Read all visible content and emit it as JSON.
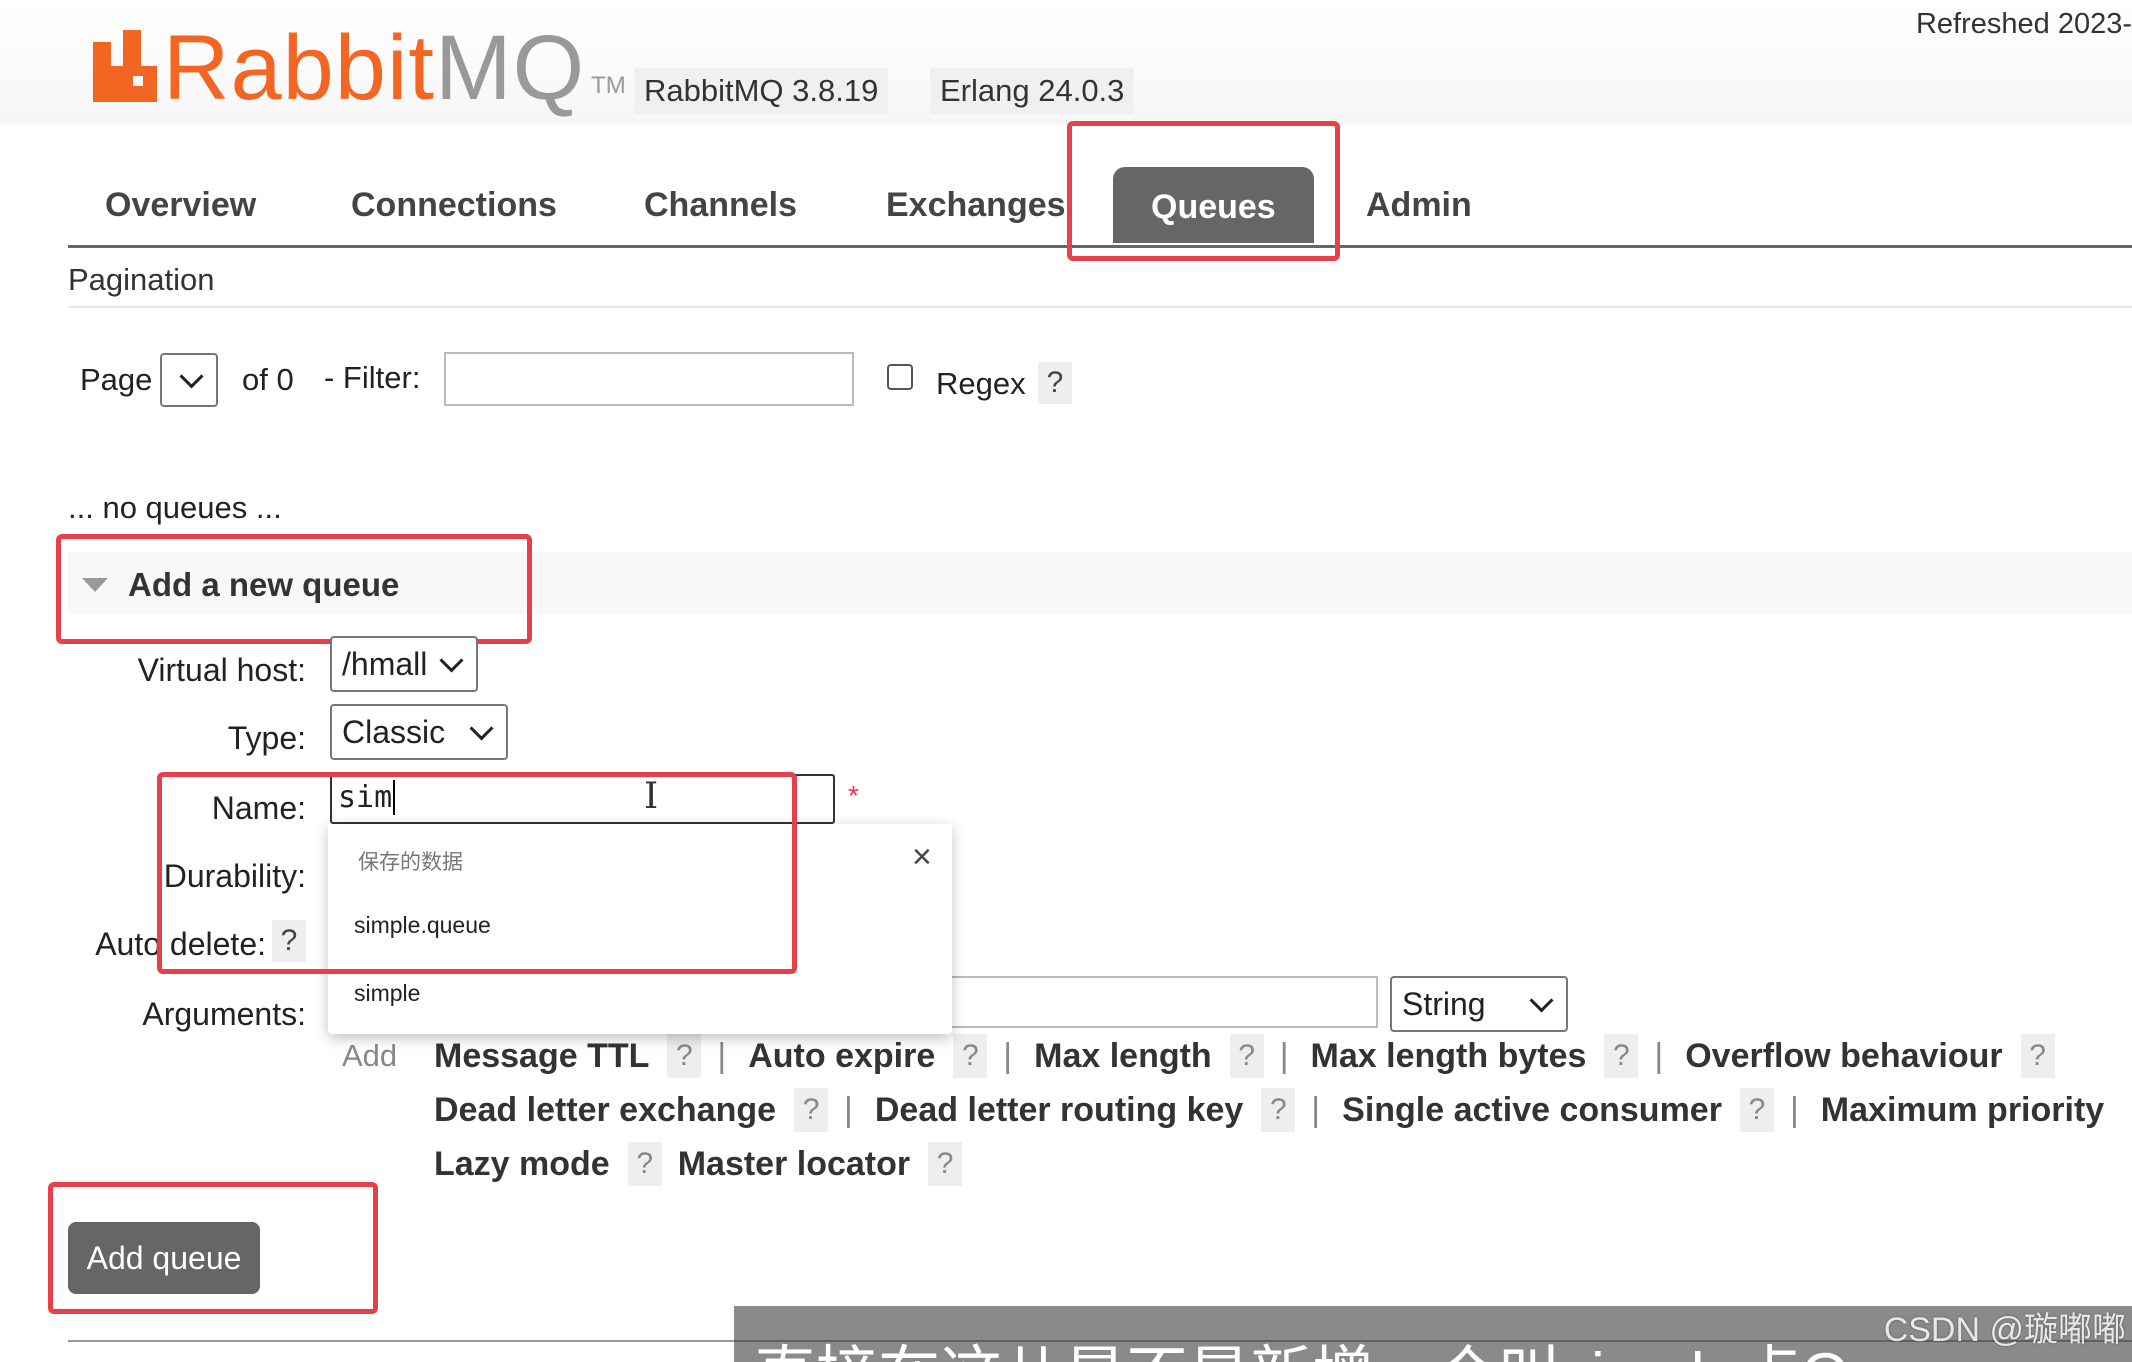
{
  "header": {
    "logo_word_1": "Rabbit",
    "logo_word_2": "MQ",
    "logo_tm": "TM",
    "version": "RabbitMQ 3.8.19",
    "erlang": "Erlang 24.0.3",
    "refreshed": "Refreshed 2023-"
  },
  "tabs": [
    {
      "label": "Overview",
      "active": false
    },
    {
      "label": "Connections",
      "active": false
    },
    {
      "label": "Channels",
      "active": false
    },
    {
      "label": "Exchanges",
      "active": false
    },
    {
      "label": "Queues",
      "active": true
    },
    {
      "label": "Admin",
      "active": false
    }
  ],
  "pagination": {
    "title": "Pagination",
    "page_label": "Page",
    "page_value": "",
    "of_label": "of 0",
    "filter_label": "- Filter:",
    "filter_value": "",
    "regex_label": "Regex",
    "regex_checked": false,
    "help": "?"
  },
  "no_queues": "... no queues ...",
  "add_queue": {
    "title": "Add a new queue",
    "virtual_host_label": "Virtual host:",
    "virtual_host_value": "/hmall",
    "type_label": "Type:",
    "type_value": "Classic",
    "name_label": "Name:",
    "name_value": "sim",
    "required_mark": "*",
    "durability_label": "Durability:",
    "auto_delete_label": "Auto delete:",
    "auto_delete_help": "?",
    "arguments_label": "Arguments:",
    "argument_type": "String",
    "add_label": "Add",
    "argument_shortcuts": [
      [
        "Message TTL",
        "Auto expire",
        "Max length",
        "Max length bytes",
        "Overflow behaviour"
      ],
      [
        "Dead letter exchange",
        "Dead letter routing key",
        "Single active consumer",
        "Maximum priority"
      ],
      [
        "Lazy mode",
        "Master locator"
      ]
    ],
    "submit_label": "Add queue"
  },
  "autocomplete": {
    "header": "保存的数据",
    "close": "×",
    "options": [
      "simple.queue",
      "simple"
    ]
  },
  "overlay": {
    "subtitle": "直接在这儿是不是新增一个叫simple点Q",
    "watermark": "CSDN @璇嘟嘟"
  },
  "colors": {
    "brand": "#f26522",
    "highlight_box": "#e8404a",
    "active_tab": "#666666"
  }
}
